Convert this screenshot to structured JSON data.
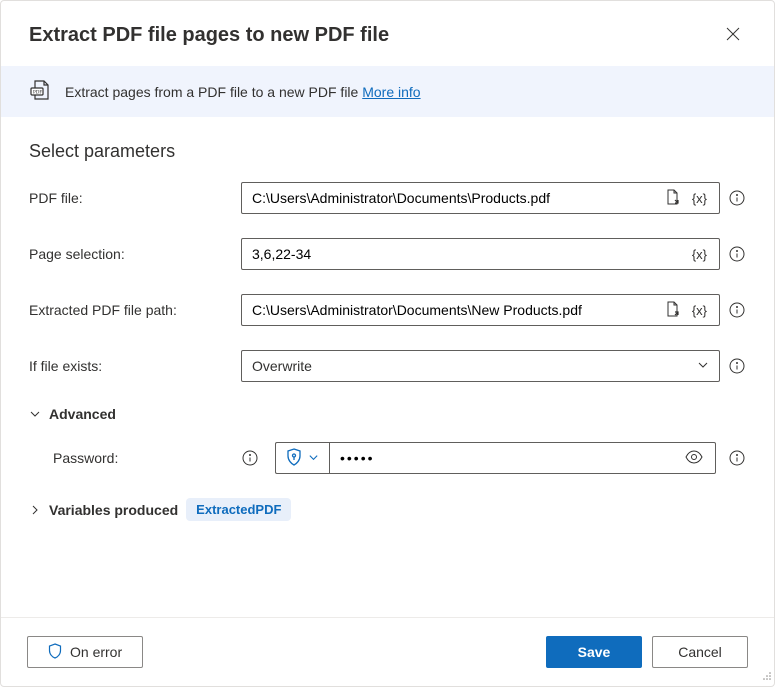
{
  "header": {
    "title": "Extract PDF file pages to new PDF file"
  },
  "banner": {
    "description": "Extract pages from a PDF file to a new PDF file",
    "link_text": "More info"
  },
  "section": {
    "title": "Select parameters"
  },
  "fields": {
    "pdf_file": {
      "label": "PDF file:",
      "value": "C:\\Users\\Administrator\\Documents\\Products.pdf",
      "var_token": "{x}"
    },
    "page_selection": {
      "label": "Page selection:",
      "value": "3,6,22-34",
      "var_token": "{x}"
    },
    "extracted_path": {
      "label": "Extracted PDF file path:",
      "value": "C:\\Users\\Administrator\\Documents\\New Products.pdf",
      "var_token": "{x}"
    },
    "if_exists": {
      "label": "If file exists:",
      "value": "Overwrite"
    },
    "password": {
      "label": "Password:",
      "value": "•••••"
    }
  },
  "advanced": {
    "label": "Advanced"
  },
  "variables_produced": {
    "label": "Variables produced",
    "chip": "ExtractedPDF"
  },
  "footer": {
    "on_error": "On error",
    "save": "Save",
    "cancel": "Cancel"
  }
}
